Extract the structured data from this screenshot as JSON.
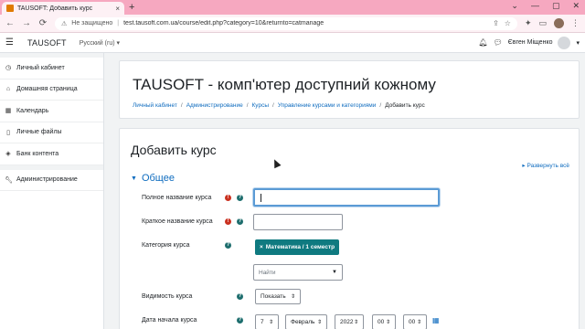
{
  "browser": {
    "tab_title": "TAUSOFT: Добавить курс",
    "tab_close": "×",
    "new_tab": "+",
    "window_controls": [
      "⌄",
      "—",
      "▢",
      "✕"
    ],
    "nav_back": "←",
    "nav_forward": "→",
    "nav_reload": "⟳",
    "security_label": "Не защищено",
    "url": "test.tausoft.com.ua/course/edit.php?category=10&returnto=catmanage"
  },
  "navbar": {
    "brand": "TAUSOFT",
    "language": "Русский (ru)",
    "user_name": "Євген Міщенко"
  },
  "sidebar": {
    "items": [
      {
        "label": "Личный кабинет",
        "icon": "dashboard-icon"
      },
      {
        "label": "Домашняя страница",
        "icon": "home-icon"
      },
      {
        "label": "Календарь",
        "icon": "calendar-icon"
      },
      {
        "label": "Личные файлы",
        "icon": "file-icon"
      },
      {
        "label": "Банк контента",
        "icon": "cube-icon"
      },
      {
        "label": "Администрирование",
        "icon": "wrench-icon"
      }
    ]
  },
  "header": {
    "title": "TAUSOFT - комп'ютер доступний кожному",
    "breadcrumb": [
      "Личный кабинет",
      "Администрирование",
      "Курсы",
      "Управление курсами и категориями",
      "Добавить курс"
    ]
  },
  "form": {
    "title": "Добавить курс",
    "expand_all": "Развернуть всё",
    "section": "Общее",
    "full_name_label": "Полное название курса",
    "full_name_value": "",
    "short_name_label": "Краткое название курса",
    "short_name_value": "",
    "category_label": "Категория курса",
    "category_chip": "Математика / 1 семестр",
    "category_search_placeholder": "Найти",
    "visibility_label": "Видимость курса",
    "visibility_value": "Показать",
    "start_date_label": "Дата начала курса",
    "start_day": "7",
    "start_month": "Февраль",
    "start_year": "2022",
    "start_hour": "00",
    "start_minute": "00"
  },
  "colors": {
    "tab_strip": "#f6a8c0",
    "link": "#0f6cbf",
    "chip": "#0f7a80",
    "required": "#ca3120"
  }
}
